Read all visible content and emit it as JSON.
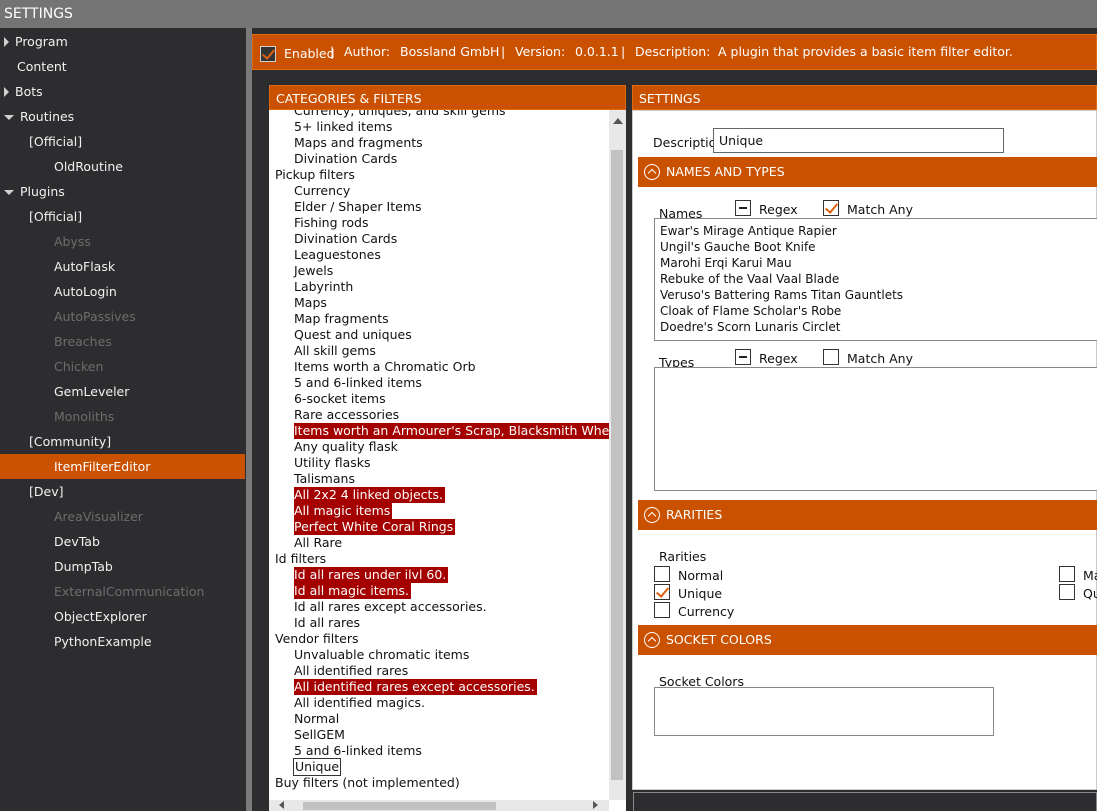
{
  "window": {
    "title": "SETTINGS"
  },
  "sidebar": {
    "items": [
      {
        "label": "Program",
        "indent": 0,
        "expander": "collapsed",
        "state": "normal"
      },
      {
        "label": "Content",
        "indent": 0,
        "expander": "none",
        "state": "normal"
      },
      {
        "label": "Bots",
        "indent": 0,
        "expander": "collapsed",
        "state": "normal"
      },
      {
        "label": "Routines",
        "indent": 0,
        "expander": "expanded",
        "state": "normal"
      },
      {
        "label": "[Official]",
        "indent": 1,
        "expander": "none",
        "state": "normal"
      },
      {
        "label": "OldRoutine",
        "indent": 2,
        "expander": "none",
        "state": "normal"
      },
      {
        "label": "Plugins",
        "indent": 0,
        "expander": "expanded",
        "state": "normal"
      },
      {
        "label": "[Official]",
        "indent": 1,
        "expander": "none",
        "state": "normal"
      },
      {
        "label": "Abyss",
        "indent": 2,
        "expander": "none",
        "state": "disabled"
      },
      {
        "label": "AutoFlask",
        "indent": 2,
        "expander": "none",
        "state": "normal"
      },
      {
        "label": "AutoLogin",
        "indent": 2,
        "expander": "none",
        "state": "normal"
      },
      {
        "label": "AutoPassives",
        "indent": 2,
        "expander": "none",
        "state": "disabled"
      },
      {
        "label": "Breaches",
        "indent": 2,
        "expander": "none",
        "state": "disabled"
      },
      {
        "label": "Chicken",
        "indent": 2,
        "expander": "none",
        "state": "disabled"
      },
      {
        "label": "GemLeveler",
        "indent": 2,
        "expander": "none",
        "state": "normal"
      },
      {
        "label": "Monoliths",
        "indent": 2,
        "expander": "none",
        "state": "disabled"
      },
      {
        "label": "[Community]",
        "indent": 1,
        "expander": "none",
        "state": "normal"
      },
      {
        "label": "ItemFilterEditor",
        "indent": 2,
        "expander": "none",
        "state": "selected"
      },
      {
        "label": "[Dev]",
        "indent": 1,
        "expander": "none",
        "state": "normal"
      },
      {
        "label": "AreaVisualizer",
        "indent": 2,
        "expander": "none",
        "state": "disabled"
      },
      {
        "label": "DevTab",
        "indent": 2,
        "expander": "none",
        "state": "normal"
      },
      {
        "label": "DumpTab",
        "indent": 2,
        "expander": "none",
        "state": "normal"
      },
      {
        "label": "ExternalCommunication",
        "indent": 2,
        "expander": "none",
        "state": "disabled"
      },
      {
        "label": "ObjectExplorer",
        "indent": 2,
        "expander": "none",
        "state": "normal"
      },
      {
        "label": "PythonExample",
        "indent": 2,
        "expander": "none",
        "state": "normal"
      }
    ]
  },
  "infobar": {
    "enabled_checked": true,
    "enabled_label": "Enabled",
    "sep": "|",
    "author_label": "Author:",
    "author": "Bossland GmbH",
    "version_label": "Version:",
    "version": "0.0.1.1",
    "description_label": "Description:",
    "description": "A plugin that provides a basic item filter editor."
  },
  "categories": {
    "header": "CATEGORIES & FILTERS",
    "items": [
      {
        "label": "Currency, uniques, and skill gems",
        "level": 1,
        "style": "normal"
      },
      {
        "label": "5+ linked items",
        "level": 1,
        "style": "normal"
      },
      {
        "label": "Maps and fragments",
        "level": 1,
        "style": "normal"
      },
      {
        "label": "Divination Cards",
        "level": 1,
        "style": "normal"
      },
      {
        "label": "Pickup filters",
        "level": 0,
        "style": "normal"
      },
      {
        "label": "Currency",
        "level": 1,
        "style": "normal"
      },
      {
        "label": "Elder / Shaper Items",
        "level": 1,
        "style": "normal"
      },
      {
        "label": "Fishing rods",
        "level": 1,
        "style": "normal"
      },
      {
        "label": "Divination Cards",
        "level": 1,
        "style": "normal"
      },
      {
        "label": "Leaguestones",
        "level": 1,
        "style": "normal"
      },
      {
        "label": "Jewels",
        "level": 1,
        "style": "normal"
      },
      {
        "label": "Labyrinth",
        "level": 1,
        "style": "normal"
      },
      {
        "label": "Maps",
        "level": 1,
        "style": "normal"
      },
      {
        "label": "Map fragments",
        "level": 1,
        "style": "normal"
      },
      {
        "label": "Quest and uniques",
        "level": 1,
        "style": "normal"
      },
      {
        "label": "All skill gems",
        "level": 1,
        "style": "normal"
      },
      {
        "label": "Items worth a Chromatic Orb",
        "level": 1,
        "style": "normal"
      },
      {
        "label": "5 and 6-linked items",
        "level": 1,
        "style": "normal"
      },
      {
        "label": "6-socket items",
        "level": 1,
        "style": "normal"
      },
      {
        "label": "Rare accessories",
        "level": 1,
        "style": "normal"
      },
      {
        "label": "Items worth an Armourer's Scrap, Blacksmith Whetsto",
        "level": 1,
        "style": "disabled"
      },
      {
        "label": "Any quality flask",
        "level": 1,
        "style": "normal"
      },
      {
        "label": "Utility flasks",
        "level": 1,
        "style": "normal"
      },
      {
        "label": "Talismans",
        "level": 1,
        "style": "normal"
      },
      {
        "label": "All 2x2 4 linked objects.",
        "level": 1,
        "style": "disabled"
      },
      {
        "label": "All magic items",
        "level": 1,
        "style": "disabled"
      },
      {
        "label": "Perfect White Coral Rings",
        "level": 1,
        "style": "disabled"
      },
      {
        "label": "All Rare",
        "level": 1,
        "style": "normal"
      },
      {
        "label": "Id filters",
        "level": 0,
        "style": "normal"
      },
      {
        "label": "Id all rares under ilvl 60.",
        "level": 1,
        "style": "disabled"
      },
      {
        "label": "Id all magic items.",
        "level": 1,
        "style": "disabled"
      },
      {
        "label": "Id all rares except accessories.",
        "level": 1,
        "style": "normal"
      },
      {
        "label": "Id all rares",
        "level": 1,
        "style": "normal"
      },
      {
        "label": "Vendor filters",
        "level": 0,
        "style": "normal"
      },
      {
        "label": "Unvaluable chromatic items",
        "level": 1,
        "style": "normal"
      },
      {
        "label": "All identified rares",
        "level": 1,
        "style": "normal"
      },
      {
        "label": "All identified rares except accessories.",
        "level": 1,
        "style": "disabled"
      },
      {
        "label": "All identified magics.",
        "level": 1,
        "style": "normal"
      },
      {
        "label": "Normal",
        "level": 1,
        "style": "normal"
      },
      {
        "label": "SellGEM",
        "level": 1,
        "style": "normal"
      },
      {
        "label": "5 and 6-linked items",
        "level": 1,
        "style": "normal"
      },
      {
        "label": "Unique",
        "level": 1,
        "style": "selected"
      },
      {
        "label": "Buy filters (not implemented)",
        "level": 0,
        "style": "normal"
      }
    ]
  },
  "settings": {
    "header": "SETTINGS",
    "description_label": "Description",
    "description_value": "Unique",
    "names_and_types": {
      "header": "NAMES AND TYPES",
      "names_label": "Names",
      "names_regex_label": "Regex",
      "names_regex_state": "indeterminate",
      "names_matchany_label": "Match Any",
      "names_matchany_state": "checked",
      "names": [
        "Ewar's Mirage Antique Rapier",
        "Ungil's Gauche Boot Knife",
        "Marohi Erqi Karui Mau",
        "Rebuke of the Vaal Vaal Blade",
        "Veruso's Battering Rams Titan Gauntlets",
        "Cloak of Flame Scholar's Robe",
        "Doedre's Scorn Lunaris Circlet"
      ],
      "types_label": "Types",
      "types_regex_label": "Regex",
      "types_regex_state": "indeterminate",
      "types_matchany_label": "Match Any",
      "types_matchany_state": "unchecked"
    },
    "rarities": {
      "header": "RARITIES",
      "label": "Rarities",
      "options": [
        {
          "label": "Normal",
          "checked": false
        },
        {
          "label": "Unique",
          "checked": true
        },
        {
          "label": "Currency",
          "checked": false
        }
      ],
      "options_right": [
        {
          "label": "Ma",
          "checked": false
        },
        {
          "label": "Qu",
          "checked": false
        }
      ]
    },
    "socket_colors": {
      "header": "SOCKET COLORS",
      "label": "Socket Colors"
    }
  },
  "colors": {
    "accent": "#CA5100",
    "disabled_row": "#A40000",
    "background": "#2D2D30"
  }
}
